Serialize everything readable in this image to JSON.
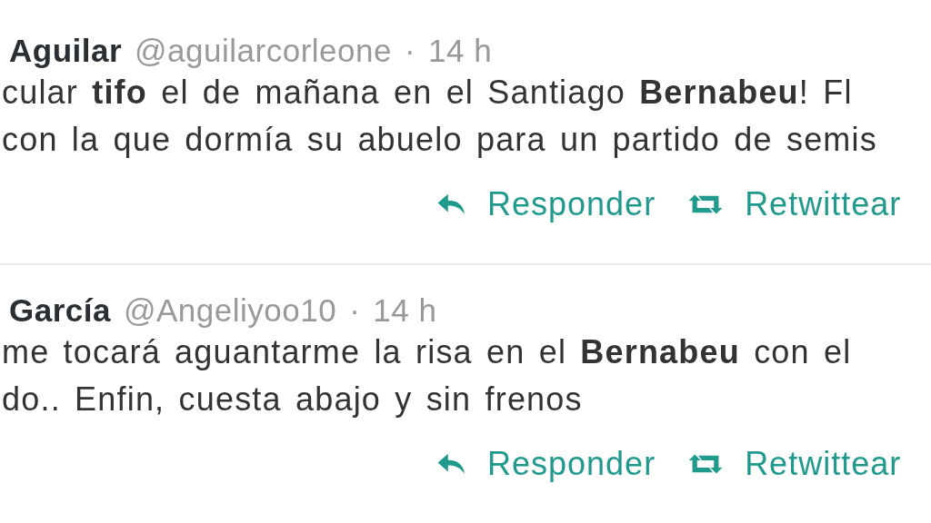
{
  "tweets": [
    {
      "name": "Aguilar",
      "handle": "@aguilarcorleone",
      "separator": "·",
      "time": "14 h",
      "lines": [
        "cular **tifo** el de mañana en el Santiago **Bernabeu**! Fl",
        "con la que dormía su abuelo para un partido de semis"
      ],
      "actions": [
        {
          "kind": "reply",
          "label": "Responder"
        },
        {
          "kind": "retweet",
          "label": "Retwittear"
        }
      ]
    },
    {
      "name": "García",
      "handle": "@Angeliyoo10",
      "separator": "·",
      "time": "14 h",
      "lines": [
        "me tocará aguantarme la risa en el **Bernabeu** con el",
        "do.. Enfin, cuesta abajo y sin frenos"
      ],
      "actions": [
        {
          "kind": "reply",
          "label": "Responder"
        },
        {
          "kind": "retweet",
          "label": "Retwittear"
        }
      ]
    }
  ]
}
